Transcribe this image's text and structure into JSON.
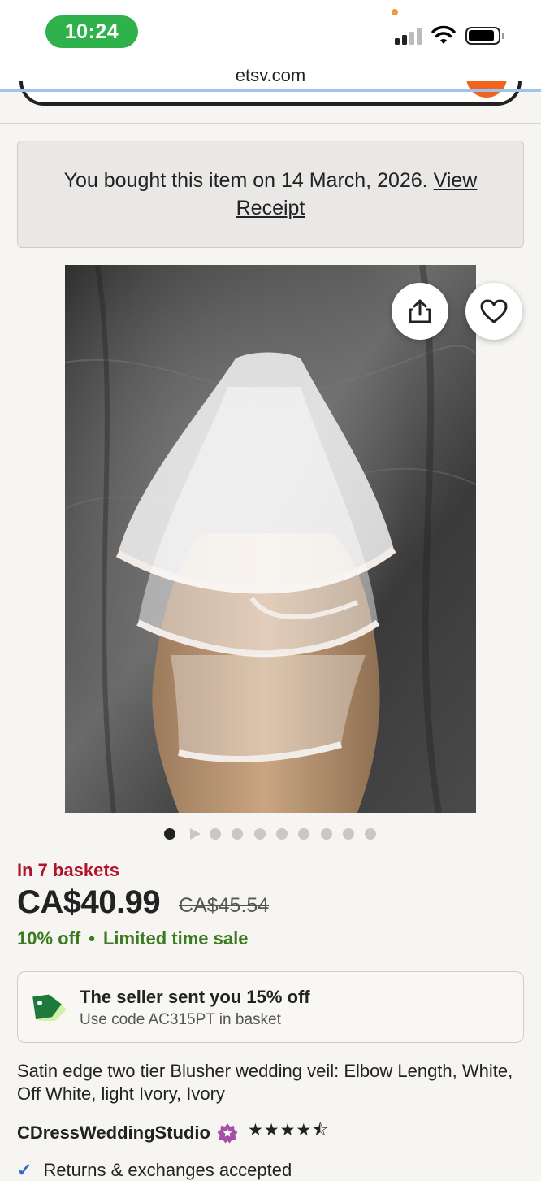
{
  "status_bar": {
    "time": "10:24"
  },
  "browser": {
    "url": "etsy.com"
  },
  "purchase_notice": {
    "text": "You bought this item on 14 March, 2026.",
    "link_label": "View Receipt"
  },
  "gallery": {
    "image_count": 10,
    "active_index": 0,
    "video_index": 1
  },
  "listing": {
    "baskets": "In 7 baskets",
    "price": "CA$40.99",
    "original_price": "CA$45.54",
    "discount": "10% off",
    "sale_label": "Limited time sale",
    "title": "Satin edge two tier Blusher wedding veil: Elbow Length, White, Off White, light Ivory, Ivory"
  },
  "coupon": {
    "title": "The seller sent you 15% off",
    "subtitle": "Use code AC315PT in basket"
  },
  "shop": {
    "name": "CDressWeddingStudio",
    "rating_stars": 4.5,
    "stars_text": "★★★★⯪"
  },
  "perks": {
    "returns": "Returns & exchanges accepted"
  },
  "colors": {
    "accent_orange": "#f1641e",
    "basket_red": "#b3122c",
    "sale_green": "#3b7a1f",
    "star_seller_purple": "#a64fa8"
  }
}
